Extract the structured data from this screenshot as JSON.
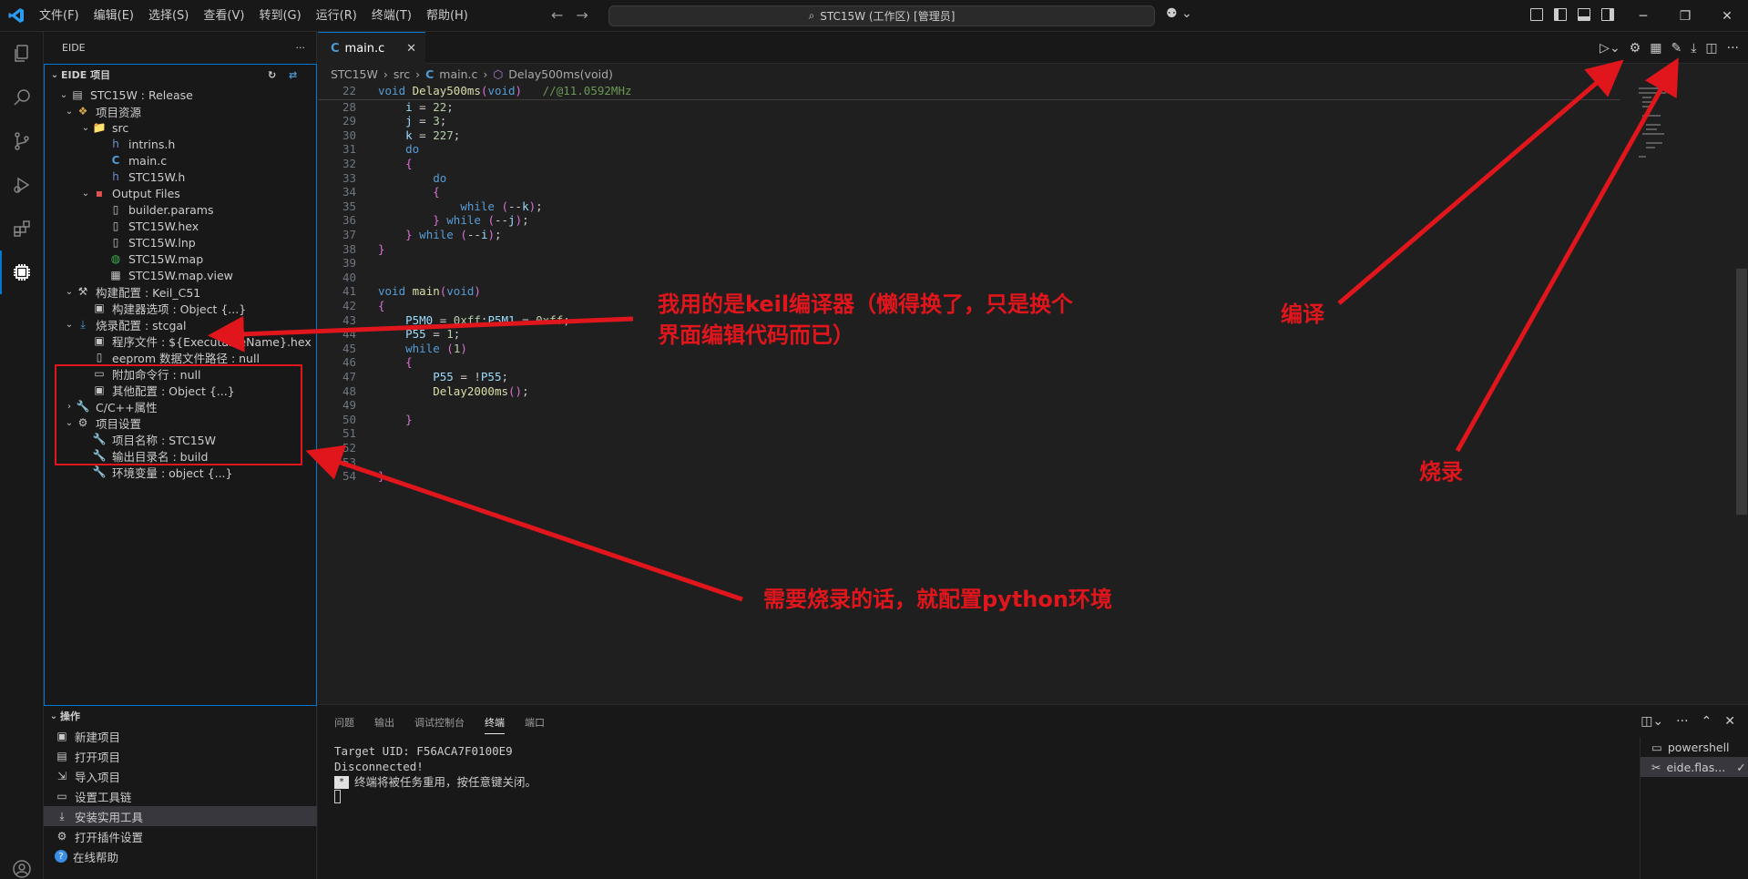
{
  "titlebar": {
    "menus": [
      "文件(F)",
      "编辑(E)",
      "选择(S)",
      "查看(V)",
      "转到(G)",
      "运行(R)",
      "终端(T)",
      "帮助(H)"
    ],
    "search_text": "STC15W (工作区) [管理员]"
  },
  "sidebar": {
    "title": "EIDE",
    "section_project": "EIDE 项目",
    "tree": [
      {
        "label": "STC15W : Release",
        "level": 1,
        "icon": "project-icon"
      },
      {
        "label": "项目资源",
        "level": 2,
        "icon": "resources-icon"
      },
      {
        "label": "src",
        "level": 3,
        "icon": "folder-icon"
      },
      {
        "label": "intrins.h",
        "level": 4,
        "icon": "h-file-icon"
      },
      {
        "label": "main.c",
        "level": 4,
        "icon": "c-file-icon"
      },
      {
        "label": "STC15W.h",
        "level": 4,
        "icon": "h-file-icon"
      },
      {
        "label": "Output Files",
        "level": 3,
        "icon": "output-folder-icon"
      },
      {
        "label": "builder.params",
        "level": 4,
        "icon": "file-icon"
      },
      {
        "label": "STC15W.hex",
        "level": 4,
        "icon": "file-icon"
      },
      {
        "label": "STC15W.lnp",
        "level": 4,
        "icon": "file-icon"
      },
      {
        "label": "STC15W.map",
        "level": 4,
        "icon": "globe-icon"
      },
      {
        "label": "STC15W.map.view",
        "level": 4,
        "icon": "map-view-icon"
      },
      {
        "label": "构建配置 : Keil_C51",
        "level": 2,
        "icon": "build-config-icon"
      },
      {
        "label": "构建器选项 : Object {...}",
        "level": 3,
        "icon": "settings-file-icon"
      },
      {
        "label": "烧录配置 : stcgal",
        "level": 2,
        "icon": "flash-icon"
      },
      {
        "label": "程序文件 : ${ExecutableName}.hex",
        "level": 3,
        "icon": "settings-file-icon"
      },
      {
        "label": "eeprom 数据文件路径 : null",
        "level": 3,
        "icon": "file-icon"
      },
      {
        "label": "附加命令行 : null",
        "level": 3,
        "icon": "terminal-icon"
      },
      {
        "label": "其他配置 : Object {...}",
        "level": 3,
        "icon": "settings-file-icon"
      },
      {
        "label": "C/C++属性",
        "level": 2,
        "icon": "wrench-icon"
      },
      {
        "label": "项目设置",
        "level": 2,
        "icon": "gear-icon"
      },
      {
        "label": "项目名称 : STC15W",
        "level": 3,
        "icon": "wrench-icon"
      },
      {
        "label": "输出目录名 : build",
        "level": 3,
        "icon": "wrench-icon"
      },
      {
        "label": "环境变量 : object {...}",
        "level": 3,
        "icon": "wrench-icon"
      }
    ],
    "section_ops": "操作",
    "ops": [
      {
        "label": "新建项目",
        "icon": "new-project-icon"
      },
      {
        "label": "打开项目",
        "icon": "open-project-icon"
      },
      {
        "label": "导入项目",
        "icon": "import-icon"
      },
      {
        "label": "设置工具链",
        "icon": "toolbox-icon"
      },
      {
        "label": "安装实用工具",
        "icon": "install-icon"
      },
      {
        "label": "打开插件设置",
        "icon": "gear-icon"
      },
      {
        "label": "在线帮助",
        "icon": "help-icon"
      }
    ]
  },
  "editor": {
    "tab_label": "main.c",
    "breadcrumb": [
      "STC15W",
      "src",
      "main.c",
      "Delay500ms(void)"
    ],
    "lines": [
      {
        "n": "22",
        "code": "void Delay500ms(void)   //@11.0592MHz"
      },
      {
        "n": "28",
        "code": "    i = 22;"
      },
      {
        "n": "29",
        "code": "    j = 3;"
      },
      {
        "n": "30",
        "code": "    k = 227;"
      },
      {
        "n": "31",
        "code": "    do"
      },
      {
        "n": "32",
        "code": "    {"
      },
      {
        "n": "33",
        "code": "        do"
      },
      {
        "n": "34",
        "code": "        {"
      },
      {
        "n": "35",
        "code": "            while (--k);"
      },
      {
        "n": "36",
        "code": "        } while (--j);"
      },
      {
        "n": "37",
        "code": "    } while (--i);"
      },
      {
        "n": "38",
        "code": "}"
      },
      {
        "n": "39",
        "code": ""
      },
      {
        "n": "40",
        "code": ""
      },
      {
        "n": "41",
        "code": "void main(void)"
      },
      {
        "n": "42",
        "code": "{"
      },
      {
        "n": "43",
        "code": "    P5M0 = 0xff;P5M1 = 0xff;"
      },
      {
        "n": "44",
        "code": "    P55 = 1;"
      },
      {
        "n": "45",
        "code": "    while (1)"
      },
      {
        "n": "46",
        "code": "    {"
      },
      {
        "n": "47",
        "code": "        P55 = !P55;"
      },
      {
        "n": "48",
        "code": "        Delay2000ms();"
      },
      {
        "n": "49",
        "code": ""
      },
      {
        "n": "50",
        "code": "    }"
      },
      {
        "n": "51",
        "code": ""
      },
      {
        "n": "52",
        "code": ""
      },
      {
        "n": "53",
        "code": ""
      },
      {
        "n": "54",
        "code": "}"
      }
    ]
  },
  "panel": {
    "tabs": [
      "问题",
      "输出",
      "调试控制台",
      "终端",
      "端口"
    ],
    "active_tab": "终端",
    "terminal_lines": [
      "Target UID: F56ACA7F0100E9",
      "Disconnected!",
      "终端将被任务重用，按任意键关闭。"
    ],
    "terminals": [
      "powershell",
      "eide.flas..."
    ]
  },
  "annotations": {
    "compiler_note_line1": "我用的是keil编译器（懒得换了，只是换个",
    "compiler_note_line2": "界面编辑代码而已）",
    "python_note": "需要烧录的话，就配置python环境",
    "compile_label": "编译",
    "flash_label": "烧录"
  },
  "colors": {
    "accent": "#0078d4",
    "annotation_red": "#e0161c",
    "keyword": "#569cd6",
    "comment": "#6a9955"
  }
}
